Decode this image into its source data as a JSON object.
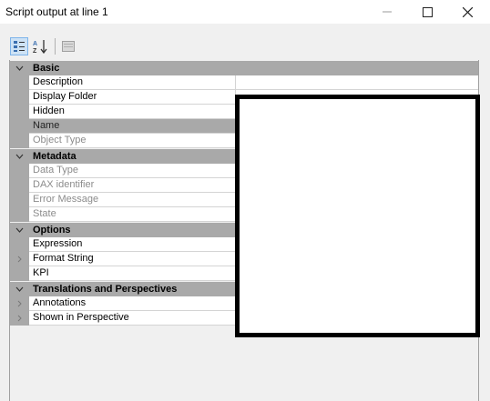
{
  "window": {
    "title": "Script output at line 1",
    "icons": [
      "minimize-icon",
      "maximize-icon",
      "close-icon"
    ]
  },
  "toolbar": {
    "buttons": [
      "categorized-icon",
      "alphabetical-sort-icon",
      "property-pages-icon"
    ]
  },
  "grid": {
    "categories": {
      "basic": "Basic",
      "metadata": "Metadata",
      "options": "Options",
      "translations": "Translations and Perspectives"
    },
    "props": {
      "description": "Description",
      "display_folder": "Display Folder",
      "hidden": "Hidden",
      "name": "Name",
      "object_type": "Object Type",
      "data_type": "Data Type",
      "dax_identifier": "DAX identifier",
      "error_message": "Error Message",
      "state": "State",
      "expression": "Expression",
      "format_string": "Format String",
      "kpi": "KPI",
      "annotations": "Annotations",
      "shown_in_perspective": "Shown in Perspective"
    }
  }
}
